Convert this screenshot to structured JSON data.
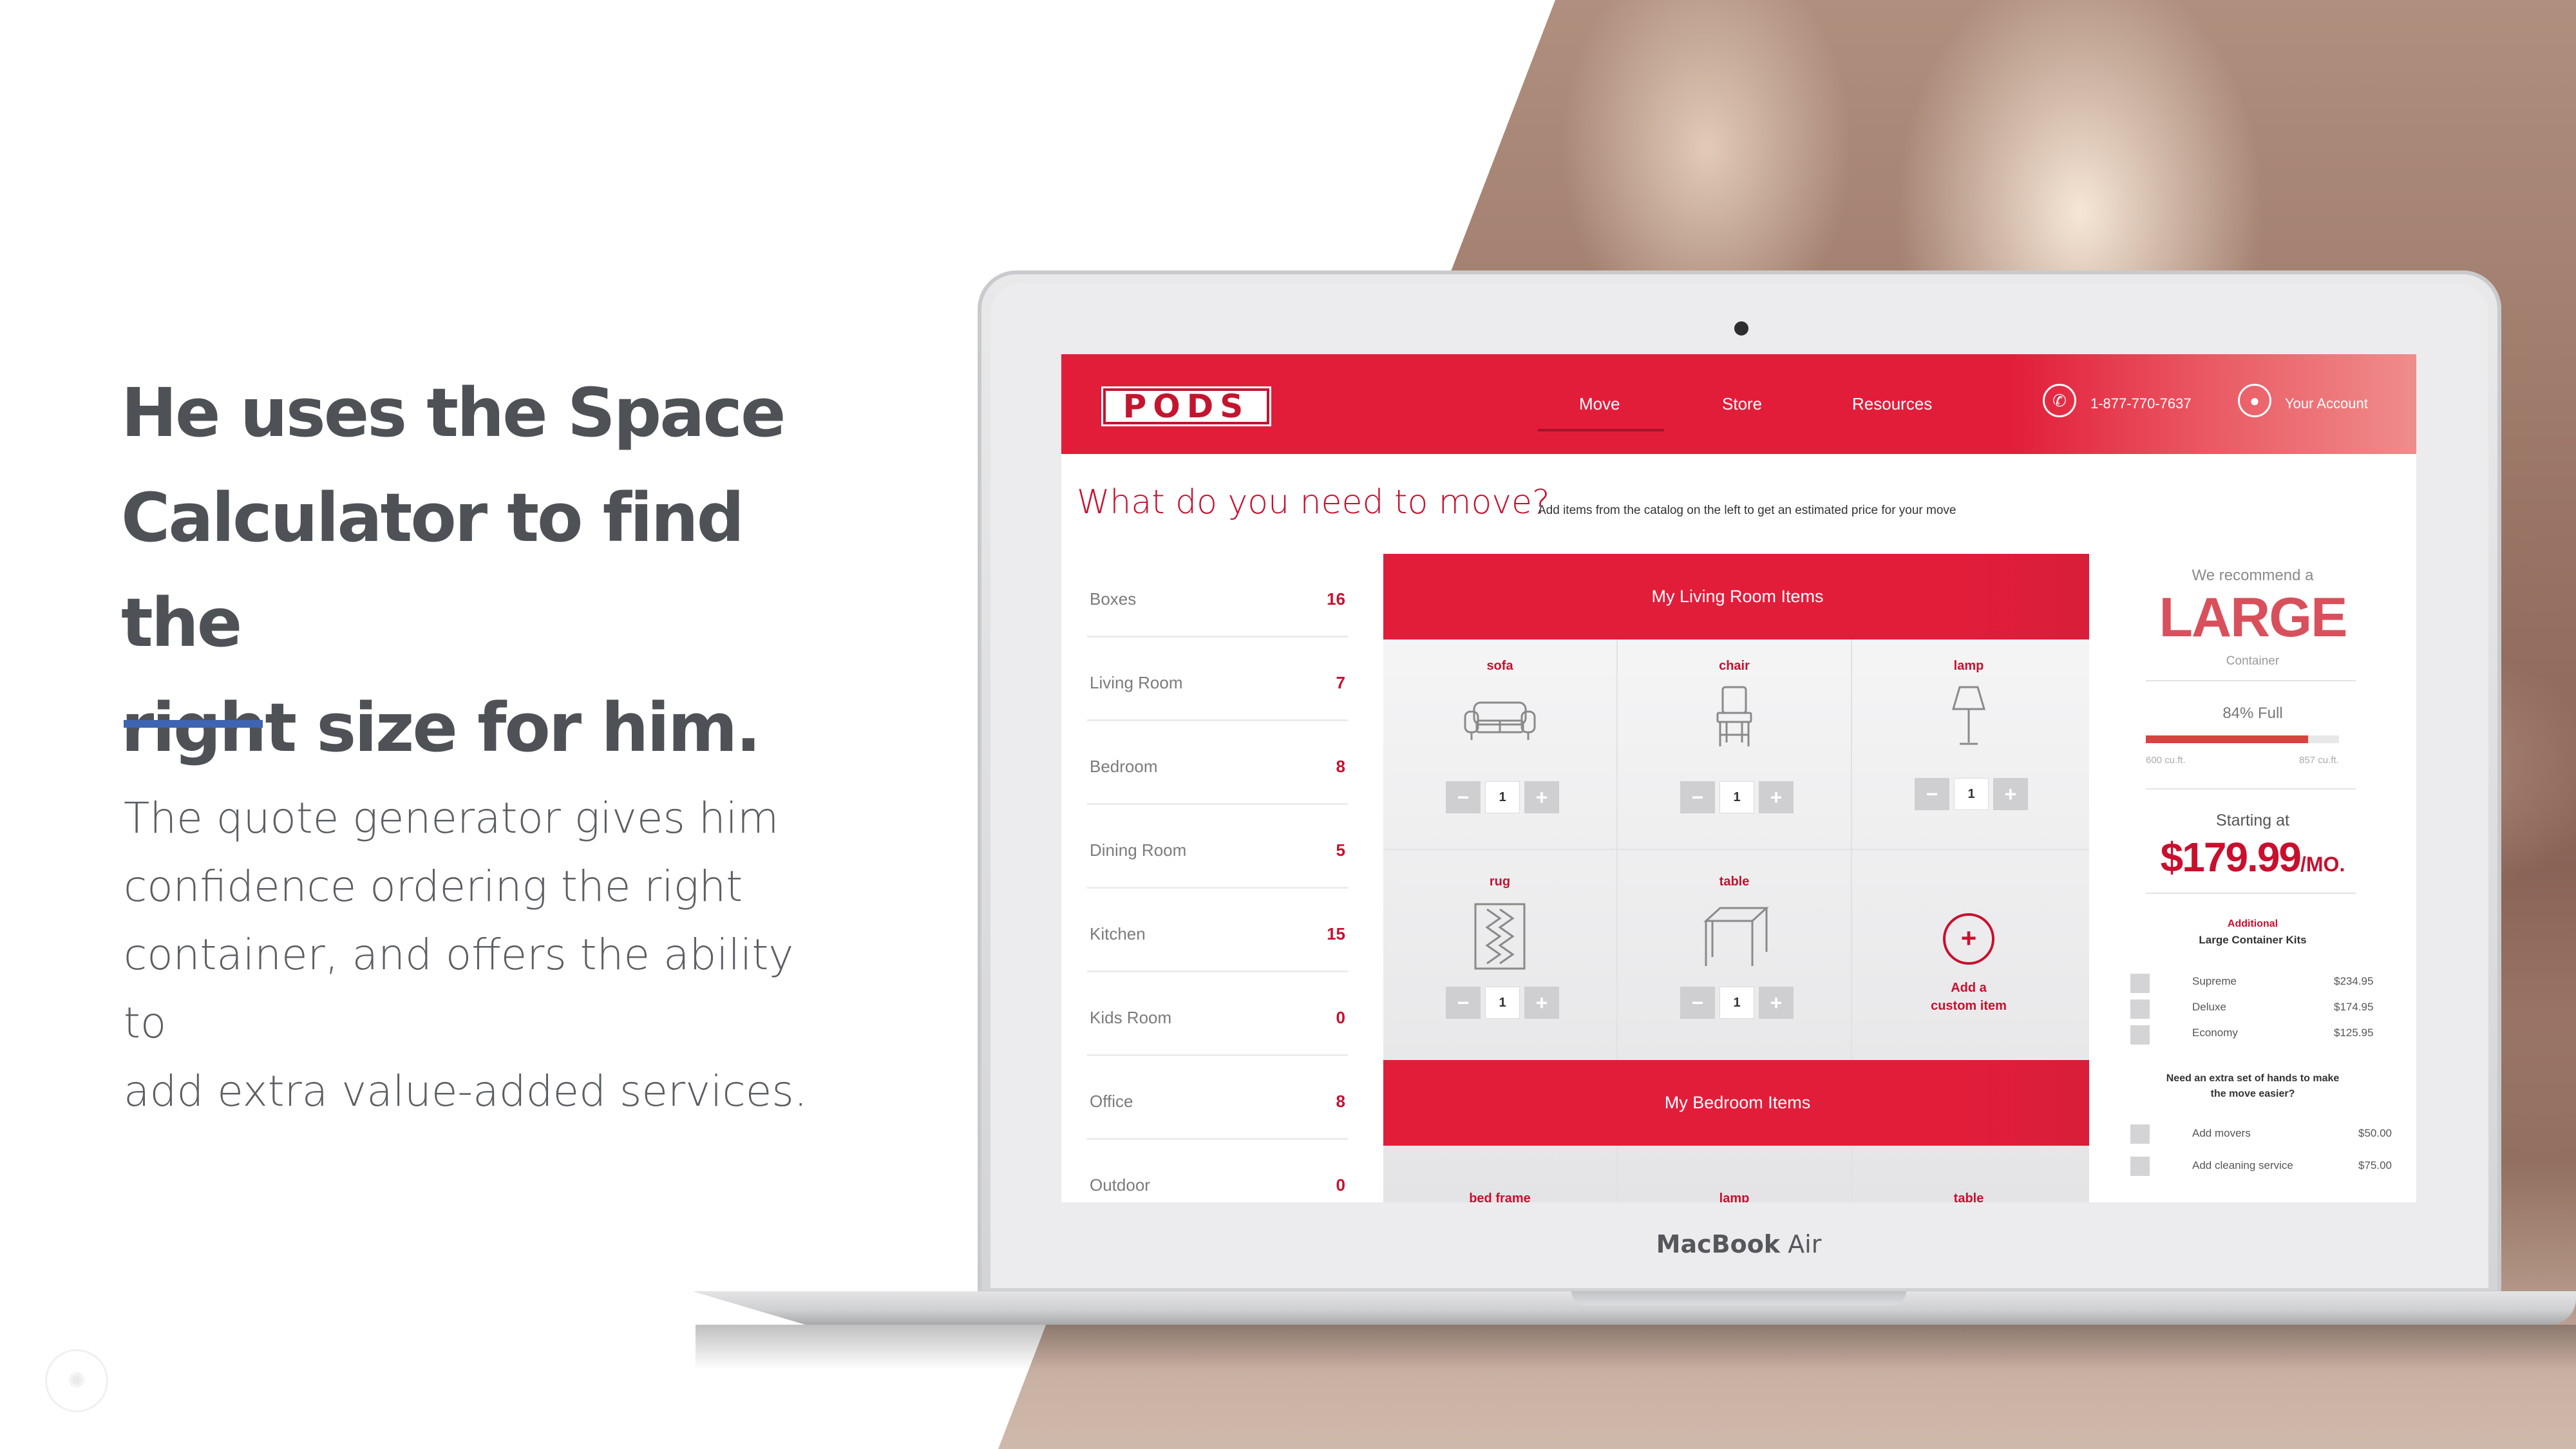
{
  "slide": {
    "headline_lines": [
      "He uses the Space",
      "Calculator to find the",
      "right size for him."
    ],
    "body_lines": [
      "The quote generator gives him",
      "confidence ordering the right",
      "container, and offers the ability to",
      "add extra value-added services."
    ],
    "accent_color": "#3e64b2"
  },
  "laptop": {
    "brand_bold": "MacBook",
    "brand_light": " Air"
  },
  "app": {
    "logo": "PODS",
    "nav": {
      "move": "Move",
      "store": "Store",
      "resources": "Resources",
      "phone": "1-877-770-7637",
      "account": "Your Account"
    },
    "title": "What do you need to move?",
    "subtitle": "Add items from the catalog on the left to get an estimated price for your move",
    "brand_color": "#e21d3a",
    "categories": [
      {
        "name": "Boxes",
        "count": "16"
      },
      {
        "name": "Living Room",
        "count": "7"
      },
      {
        "name": "Bedroom",
        "count": "8"
      },
      {
        "name": "Dining Room",
        "count": "5"
      },
      {
        "name": "Kitchen",
        "count": "15"
      },
      {
        "name": "Kids Room",
        "count": "0"
      },
      {
        "name": "Office",
        "count": "8"
      },
      {
        "name": "Outdoor",
        "count": "0"
      }
    ],
    "living_room": {
      "heading": "My Living Room Items",
      "items": [
        {
          "name": "sofa",
          "icon": "sofa-icon",
          "qty": "1"
        },
        {
          "name": "chair",
          "icon": "chair-icon",
          "qty": "1"
        },
        {
          "name": "lamp",
          "icon": "lamp-icon",
          "qty": "1"
        },
        {
          "name": "rug",
          "icon": "rug-icon",
          "qty": "1"
        },
        {
          "name": "table",
          "icon": "table-icon",
          "qty": "1"
        }
      ],
      "add_custom_line1": "Add a",
      "add_custom_line2": "custom item"
    },
    "bedroom": {
      "heading": "My Bedroom Items",
      "partial_items": [
        "bed frame",
        "lamp",
        "table"
      ]
    },
    "sidebar": {
      "recommend": "We recommend a",
      "size": "LARGE",
      "container": "Container",
      "full_label": "84% Full",
      "full_fraction": 0.84,
      "range_min": "600 cu.ft.",
      "range_max": "857 cu.ft.",
      "starting_at": "Starting at",
      "price": "$179.99",
      "per": "/MO.",
      "kits_title_1": "Additional",
      "kits_title_2": "Large Container Kits",
      "kits": [
        {
          "name": "Supreme",
          "price": "$234.95"
        },
        {
          "name": "Deluxe",
          "price": "$174.95"
        },
        {
          "name": "Economy",
          "price": "$125.95"
        }
      ],
      "extra_q1": "Need an extra set of hands to make",
      "extra_q2": "the move easier?",
      "services": [
        {
          "name": "Add movers",
          "price": "$50.00"
        },
        {
          "name": "Add cleaning service",
          "price": "$75.00"
        }
      ]
    }
  }
}
